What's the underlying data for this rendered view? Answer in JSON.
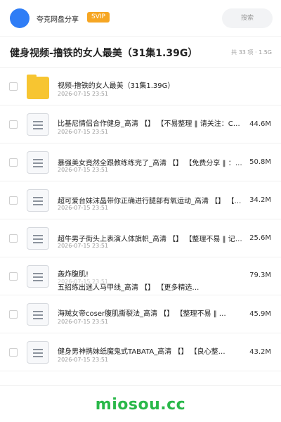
{
  "header": {
    "username": "夸克网盘分享",
    "badge": "SVIP",
    "search_placeholder": "搜索",
    "accent": "#2f7df6",
    "badge_color": "#f6a623"
  },
  "share": {
    "title": "健身视频-撸铁的女人最美（31集1.39G）",
    "meta": "共 33 项 · 1.5G"
  },
  "files": [
    {
      "icon": "folder-icon",
      "name": "视频-撸铁的女人最美（31集1.39G）",
      "date": "2026-07-15 23:51",
      "size": ""
    },
    {
      "icon": "video-file-icon",
      "name": "比基尼情侣合作健身_高清 【】 【不易整理 ‖ 请关注：C…",
      "date": "2026-07-15 23:51",
      "size": "44.6M"
    },
    {
      "icon": "video-file-icon",
      "name": "暴强美女竟然全跟教练练完了_高清 【】 【免费分享 ‖ ：…",
      "date": "2026-07-15 23:51",
      "size": "50.8M"
    },
    {
      "icon": "video-file-icon",
      "name": "超可爱台妹沫晶带你正确进行腿部有氧运动_高清 【】 【…",
      "date": "2026-07-15 23:51",
      "size": "34.2M"
    },
    {
      "icon": "video-file-icon",
      "name": "超牛男子街头上表演人体旗帜_高清 【】 【整理不易 ‖ 记…",
      "date": "2026-07-15 23:51",
      "size": "25.6M"
    },
    {
      "icon": "video-file-icon",
      "name_line1": "轰炸腹肌!",
      "name_line2": "五招练出迷人马甲线_高清 【】 【更多精选…",
      "date": "2026-07-15 23:51",
      "size": "79.3M"
    },
    {
      "icon": "video-file-icon",
      "name": "海贼女帝coser腹肌撕裂法_高清 【】 【整理不易 ‖ …",
      "date": "2026-07-15 23:51",
      "size": "45.9M"
    },
    {
      "icon": "video-file-icon",
      "name": "健身男神携妹纸魔鬼式TABATA_高清 【】 【良心整…",
      "date": "2026-07-15 23:51",
      "size": "43.2M"
    }
  ],
  "footer": {
    "brand": "miosou.cc",
    "brand_color": "#2ab84a"
  }
}
